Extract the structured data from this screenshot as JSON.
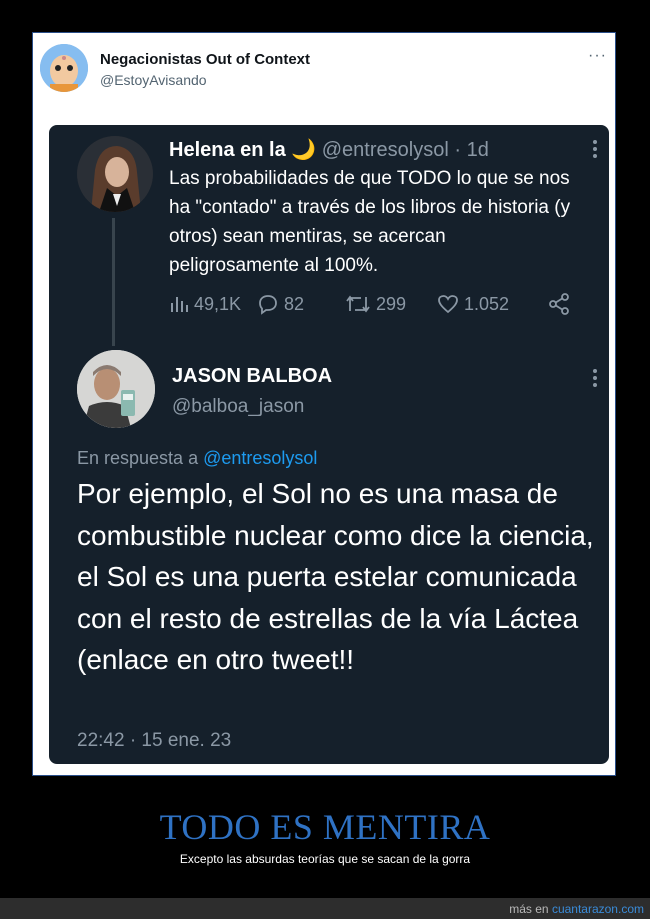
{
  "outer_tweet": {
    "display_name": "Negacionistas Out of Context",
    "handle": "@EstoyAvisando",
    "more": "···"
  },
  "quoted_tweet": {
    "display_name": "Helena en la",
    "name_emoji": "🌙",
    "handle": "@entresolysol",
    "separator": "·",
    "age": "1d",
    "text": "Las probabilidades de que TODO lo que se nos ha \"contado\" a través de los libros de historia (y otros) sean mentiras, se acercan peligrosamente al 100%.",
    "stats": {
      "views": "49,1K",
      "replies": "82",
      "retweets": "299",
      "likes": "1.052"
    }
  },
  "reply_tweet": {
    "display_name": "JASON BALBOA",
    "handle": "@balboa_jason",
    "reply_prefix": "En respuesta a",
    "reply_handle": "@entresolysol",
    "text": "Por ejemplo, el Sol no es una masa de combustible nuclear como dice la ciencia, el Sol es una puerta estelar comunicada con el resto de estrellas de la vía Láctea (enlace en otro tweet!!",
    "timestamp": "22:42 · 15 ene. 23"
  },
  "caption": {
    "title": "TODO ES MENTIRA",
    "subtitle": "Excepto las absurdas teorías que se sacan de la gorra"
  },
  "footer": {
    "prefix": "más en",
    "site": "cuantarazon.com"
  },
  "colors": {
    "card_bg": "#15202b",
    "link_blue": "#1d9bf0",
    "caption_blue": "#2f72c4",
    "muted_gray": "#8b98a5"
  }
}
